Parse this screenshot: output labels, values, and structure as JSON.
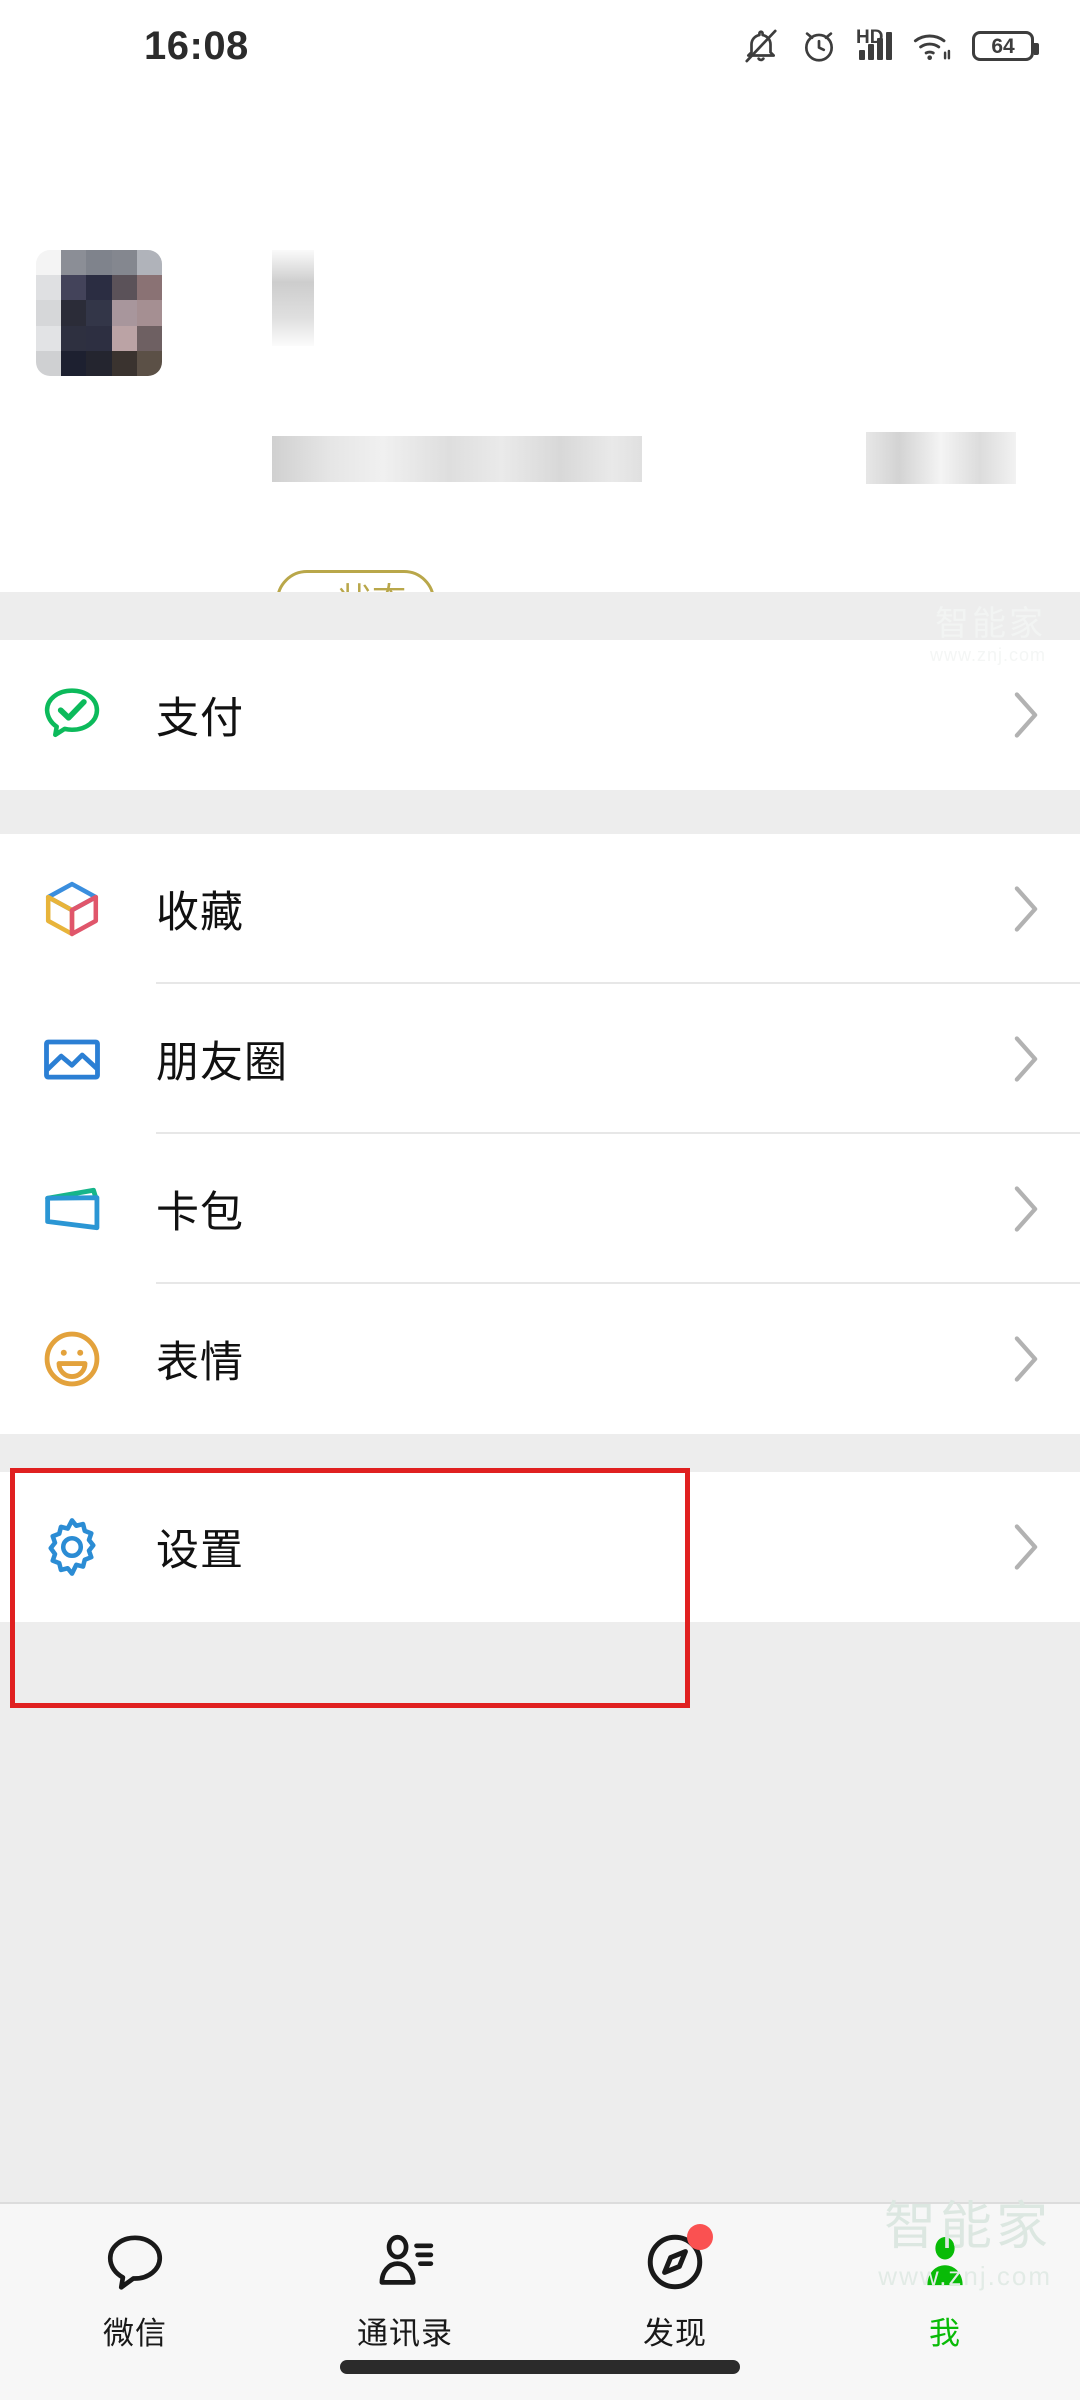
{
  "status_bar": {
    "time": "16:08",
    "battery_level": "64",
    "network_label": "HD",
    "icons": [
      "mute-bell-icon",
      "alarm-clock-icon",
      "hd-signal-icon",
      "wifi-icon",
      "battery-icon"
    ]
  },
  "profile": {
    "name": "",
    "wechat_id": "",
    "status_button": {
      "plus": "+",
      "label": "状态"
    }
  },
  "sections": [
    {
      "rows": [
        {
          "label": "支付",
          "icon": "payment-icon",
          "color": "#0cba5b"
        }
      ]
    },
    {
      "rows": [
        {
          "label": "收藏",
          "icon": "favorites-cube-icon",
          "color": "#3a8ede"
        },
        {
          "label": "朋友圈",
          "icon": "moments-photo-icon",
          "color": "#2b7fd4"
        },
        {
          "label": "卡包",
          "icon": "cards-wallet-icon",
          "color": "#2b96d4"
        },
        {
          "label": "表情",
          "icon": "stickers-smiley-icon",
          "color": "#e3a23c"
        }
      ]
    },
    {
      "rows": [
        {
          "label": "设置",
          "icon": "settings-gear-icon",
          "color": "#2b8cd4"
        }
      ]
    }
  ],
  "annotation": {
    "color": "#e02020",
    "target": "设置"
  },
  "tabbar": {
    "items": [
      {
        "label": "微信",
        "icon": "chat-bubble-icon",
        "active": false,
        "badge": false
      },
      {
        "label": "通讯录",
        "icon": "contacts-person-icon",
        "active": false,
        "badge": false
      },
      {
        "label": "发现",
        "icon": "discover-compass-icon",
        "active": false,
        "badge": true
      },
      {
        "label": "我",
        "icon": "me-person-icon",
        "active": true,
        "badge": false
      }
    ],
    "active_color": "#09bb07",
    "badge_color": "#fa5151"
  },
  "watermark": {
    "line1": "智能家",
    "line2": "www.znj.com"
  }
}
